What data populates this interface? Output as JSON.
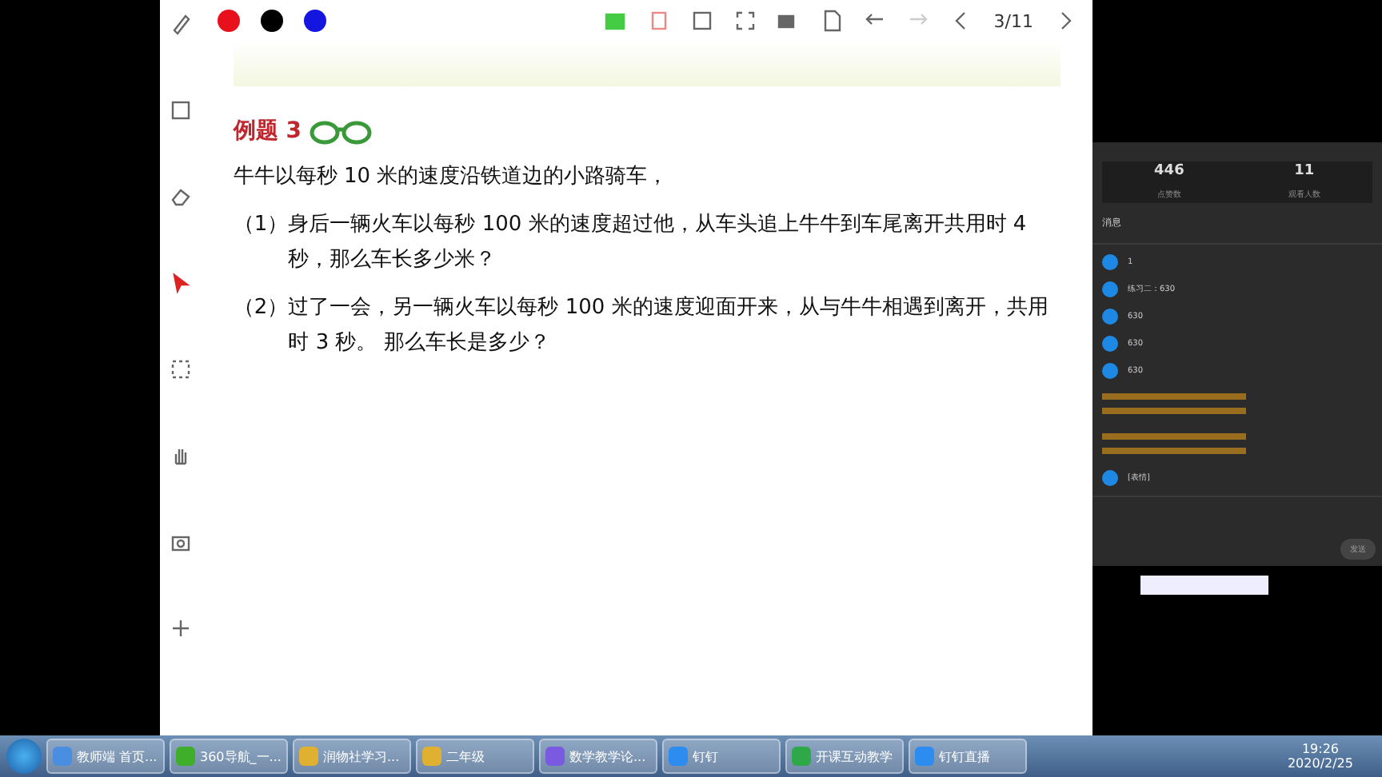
{
  "toolbar": {
    "colors": [
      {
        "color": "#e8101a"
      },
      {
        "color": "#000000"
      },
      {
        "color": "#1515e0"
      }
    ],
    "page": "3/11"
  },
  "problem": {
    "title": "例题 3",
    "lines": [
      {
        "kind": "plain",
        "text": "牛牛以每秒 10 米的速度沿铁道边的小路骑车，"
      },
      {
        "kind": "item",
        "num": "（1）",
        "text": "身后一辆火车以每秒 100 米的速度超过他，从车头追上牛牛到车尾离开共用时 4 秒，那么车长多少米？"
      },
      {
        "kind": "item",
        "num": "（2）",
        "text": "过了一会，另一辆火车以每秒 100 米的速度迎面开来，从与牛牛相遇到离开，共用时 3 秒。 那么车长是多少？"
      }
    ]
  },
  "chat": {
    "stats": [
      {
        "value": "446",
        "label": "点赞数"
      },
      {
        "value": "11",
        "label": "观看人数"
      }
    ],
    "header": "消息",
    "messages": [
      {
        "kind": "user",
        "text": "1"
      },
      {
        "kind": "user",
        "text": "练习二：630"
      },
      {
        "kind": "user",
        "text": "630"
      },
      {
        "kind": "user",
        "text": "630"
      },
      {
        "kind": "user",
        "text": "630"
      },
      {
        "kind": "notice"
      },
      {
        "kind": "notice"
      },
      {
        "kind": "user",
        "text": "[表情]"
      }
    ],
    "send": "发送"
  },
  "taskbar": {
    "items": [
      {
        "label": "教师端 首页...",
        "color": "#4a8ee0"
      },
      {
        "label": "360导航_一...",
        "color": "#3fae2a"
      },
      {
        "label": "润物社学习...",
        "color": "#e0b030"
      },
      {
        "label": "二年级",
        "color": "#e0b030"
      },
      {
        "label": "数学教学论...",
        "color": "#7a5ae0"
      },
      {
        "label": "钉钉",
        "color": "#2d8cf0"
      },
      {
        "label": "开课互动教学",
        "color": "#2fa84a"
      },
      {
        "label": "钉钉直播",
        "color": "#2d8cf0"
      }
    ],
    "time": "19:26",
    "date": "2020/2/25"
  }
}
